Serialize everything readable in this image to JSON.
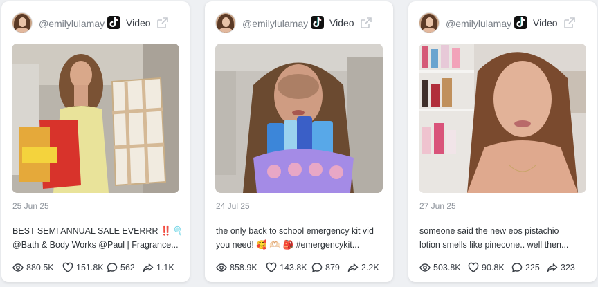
{
  "cards": [
    {
      "handle": "@emilylulamay",
      "type_label": "Video",
      "date": "25 Jun 25",
      "caption_line1": "BEST SEMI ANNUAL SALE EVERRR ‼️ 🫧 🧽",
      "caption_line2": "@Bath & Body Works @Paul | Fragrance...",
      "views": "880.5K",
      "likes": "151.8K",
      "comments": "562",
      "shares": "1.1K"
    },
    {
      "handle": "@emilylulamay",
      "type_label": "Video",
      "date": "24 Jul 25",
      "caption_line1": "the only back to school emergency kit vid",
      "caption_line2": "you need! 🥰 🫶🏻 🎒 #emergencykit...",
      "views": "858.9K",
      "likes": "143.8K",
      "comments": "879",
      "shares": "2.2K"
    },
    {
      "handle": "@emilylulamay",
      "type_label": "Video",
      "date": "27 Jun 25",
      "caption_line1": "someone said the new eos pistachio",
      "caption_line2": "lotion smells like pinecone.. well then...",
      "views": "503.8K",
      "likes": "90.8K",
      "comments": "225",
      "shares": "323"
    }
  ],
  "colors": {
    "page_bg": "#eef0f3",
    "card_bg": "#ffffff",
    "text_muted": "#8d939b",
    "text_main": "#2e3338"
  },
  "icons": [
    "tiktok-logo-icon",
    "external-link-icon",
    "eye-icon",
    "heart-icon",
    "comment-icon",
    "share-icon"
  ]
}
